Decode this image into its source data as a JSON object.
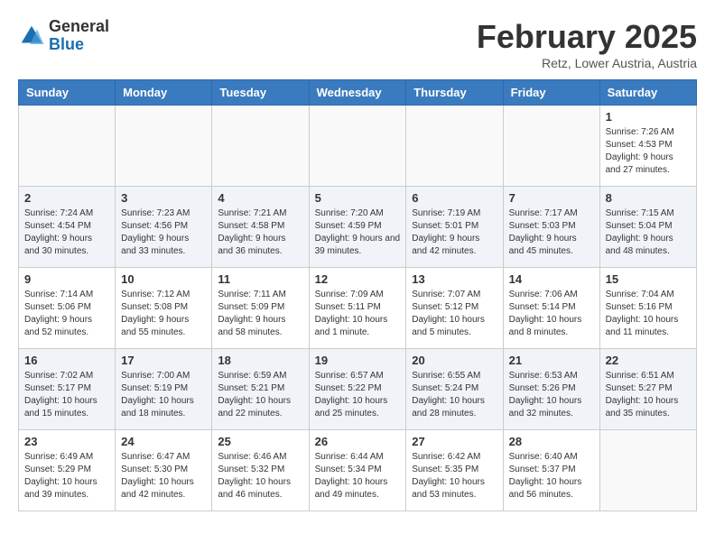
{
  "header": {
    "logo_general": "General",
    "logo_blue": "Blue",
    "month_title": "February 2025",
    "location": "Retz, Lower Austria, Austria"
  },
  "days_of_week": [
    "Sunday",
    "Monday",
    "Tuesday",
    "Wednesday",
    "Thursday",
    "Friday",
    "Saturday"
  ],
  "weeks": [
    {
      "days": [
        {
          "num": "",
          "info": ""
        },
        {
          "num": "",
          "info": ""
        },
        {
          "num": "",
          "info": ""
        },
        {
          "num": "",
          "info": ""
        },
        {
          "num": "",
          "info": ""
        },
        {
          "num": "",
          "info": ""
        },
        {
          "num": "1",
          "info": "Sunrise: 7:26 AM\nSunset: 4:53 PM\nDaylight: 9 hours and 27 minutes."
        }
      ]
    },
    {
      "days": [
        {
          "num": "2",
          "info": "Sunrise: 7:24 AM\nSunset: 4:54 PM\nDaylight: 9 hours and 30 minutes."
        },
        {
          "num": "3",
          "info": "Sunrise: 7:23 AM\nSunset: 4:56 PM\nDaylight: 9 hours and 33 minutes."
        },
        {
          "num": "4",
          "info": "Sunrise: 7:21 AM\nSunset: 4:58 PM\nDaylight: 9 hours and 36 minutes."
        },
        {
          "num": "5",
          "info": "Sunrise: 7:20 AM\nSunset: 4:59 PM\nDaylight: 9 hours and 39 minutes."
        },
        {
          "num": "6",
          "info": "Sunrise: 7:19 AM\nSunset: 5:01 PM\nDaylight: 9 hours and 42 minutes."
        },
        {
          "num": "7",
          "info": "Sunrise: 7:17 AM\nSunset: 5:03 PM\nDaylight: 9 hours and 45 minutes."
        },
        {
          "num": "8",
          "info": "Sunrise: 7:15 AM\nSunset: 5:04 PM\nDaylight: 9 hours and 48 minutes."
        }
      ]
    },
    {
      "days": [
        {
          "num": "9",
          "info": "Sunrise: 7:14 AM\nSunset: 5:06 PM\nDaylight: 9 hours and 52 minutes."
        },
        {
          "num": "10",
          "info": "Sunrise: 7:12 AM\nSunset: 5:08 PM\nDaylight: 9 hours and 55 minutes."
        },
        {
          "num": "11",
          "info": "Sunrise: 7:11 AM\nSunset: 5:09 PM\nDaylight: 9 hours and 58 minutes."
        },
        {
          "num": "12",
          "info": "Sunrise: 7:09 AM\nSunset: 5:11 PM\nDaylight: 10 hours and 1 minute."
        },
        {
          "num": "13",
          "info": "Sunrise: 7:07 AM\nSunset: 5:12 PM\nDaylight: 10 hours and 5 minutes."
        },
        {
          "num": "14",
          "info": "Sunrise: 7:06 AM\nSunset: 5:14 PM\nDaylight: 10 hours and 8 minutes."
        },
        {
          "num": "15",
          "info": "Sunrise: 7:04 AM\nSunset: 5:16 PM\nDaylight: 10 hours and 11 minutes."
        }
      ]
    },
    {
      "days": [
        {
          "num": "16",
          "info": "Sunrise: 7:02 AM\nSunset: 5:17 PM\nDaylight: 10 hours and 15 minutes."
        },
        {
          "num": "17",
          "info": "Sunrise: 7:00 AM\nSunset: 5:19 PM\nDaylight: 10 hours and 18 minutes."
        },
        {
          "num": "18",
          "info": "Sunrise: 6:59 AM\nSunset: 5:21 PM\nDaylight: 10 hours and 22 minutes."
        },
        {
          "num": "19",
          "info": "Sunrise: 6:57 AM\nSunset: 5:22 PM\nDaylight: 10 hours and 25 minutes."
        },
        {
          "num": "20",
          "info": "Sunrise: 6:55 AM\nSunset: 5:24 PM\nDaylight: 10 hours and 28 minutes."
        },
        {
          "num": "21",
          "info": "Sunrise: 6:53 AM\nSunset: 5:26 PM\nDaylight: 10 hours and 32 minutes."
        },
        {
          "num": "22",
          "info": "Sunrise: 6:51 AM\nSunset: 5:27 PM\nDaylight: 10 hours and 35 minutes."
        }
      ]
    },
    {
      "days": [
        {
          "num": "23",
          "info": "Sunrise: 6:49 AM\nSunset: 5:29 PM\nDaylight: 10 hours and 39 minutes."
        },
        {
          "num": "24",
          "info": "Sunrise: 6:47 AM\nSunset: 5:30 PM\nDaylight: 10 hours and 42 minutes."
        },
        {
          "num": "25",
          "info": "Sunrise: 6:46 AM\nSunset: 5:32 PM\nDaylight: 10 hours and 46 minutes."
        },
        {
          "num": "26",
          "info": "Sunrise: 6:44 AM\nSunset: 5:34 PM\nDaylight: 10 hours and 49 minutes."
        },
        {
          "num": "27",
          "info": "Sunrise: 6:42 AM\nSunset: 5:35 PM\nDaylight: 10 hours and 53 minutes."
        },
        {
          "num": "28",
          "info": "Sunrise: 6:40 AM\nSunset: 5:37 PM\nDaylight: 10 hours and 56 minutes."
        },
        {
          "num": "",
          "info": ""
        }
      ]
    }
  ]
}
